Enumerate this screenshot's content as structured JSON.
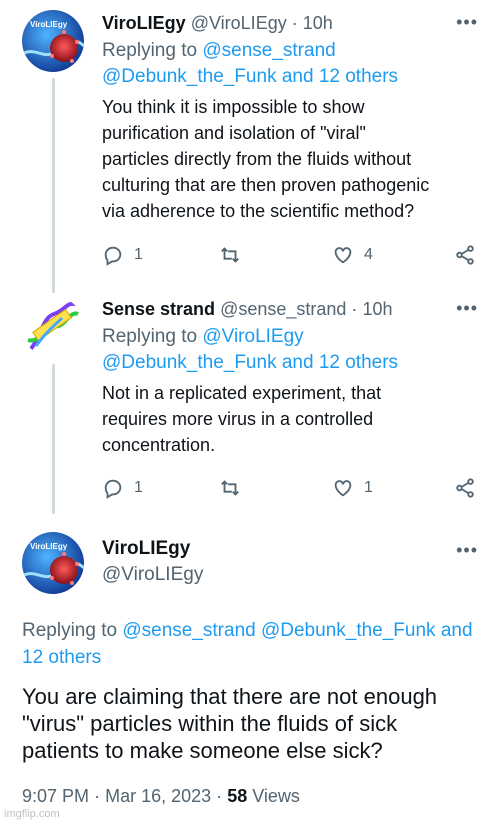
{
  "tweets": [
    {
      "display_name": "ViroLIEgy",
      "handle": "@ViroLIEgy",
      "separator": "·",
      "time": "10h",
      "replying_prefix": "Replying to",
      "replying_mention": "@sense_strand",
      "replying_rest": "@Debunk_the_Funk and 12 others",
      "text_lines": [
        "You think it is impossible to show",
        "purification and isolation of \"viral\"",
        "particles directly from the fluids without",
        "culturing that are then proven pathogenic",
        "via adherence to the scientific method?"
      ],
      "reply_count": "1",
      "retweet_count": "",
      "like_count": "4",
      "avatar_logo_text": "ViroLIEgy"
    },
    {
      "display_name": "Sense strand",
      "handle": "@sense_strand",
      "separator": "·",
      "time": "10h",
      "replying_prefix": "Replying to",
      "replying_mention": "@ViroLIEgy",
      "replying_rest": "@Debunk_the_Funk and 12 others",
      "text_lines": [
        "Not in a replicated experiment, that",
        "requires more virus in a controlled",
        "concentration."
      ],
      "reply_count": "1",
      "retweet_count": "",
      "like_count": "1"
    }
  ],
  "main_tweet": {
    "display_name": "ViroLIEgy",
    "handle": "@ViroLIEgy",
    "replying_prefix": "Replying to",
    "replying_mentions": "@sense_strand @Debunk_the_Funk and",
    "replying_rest": "12 others",
    "text_lines": [
      "You are claiming that there are not enough",
      "\"virus\" particles within the fluids of sick",
      "patients to make someone else sick?"
    ],
    "time": "9:07 PM",
    "separator": "·",
    "date": "Mar 16, 2023",
    "views_count": "58",
    "views_label": "Views"
  },
  "more_glyph": "•••",
  "watermark": "imgflip.com",
  "colors": {
    "link": "#1d9bf0",
    "muted": "#536471",
    "thread_line": "#cfd9de"
  }
}
